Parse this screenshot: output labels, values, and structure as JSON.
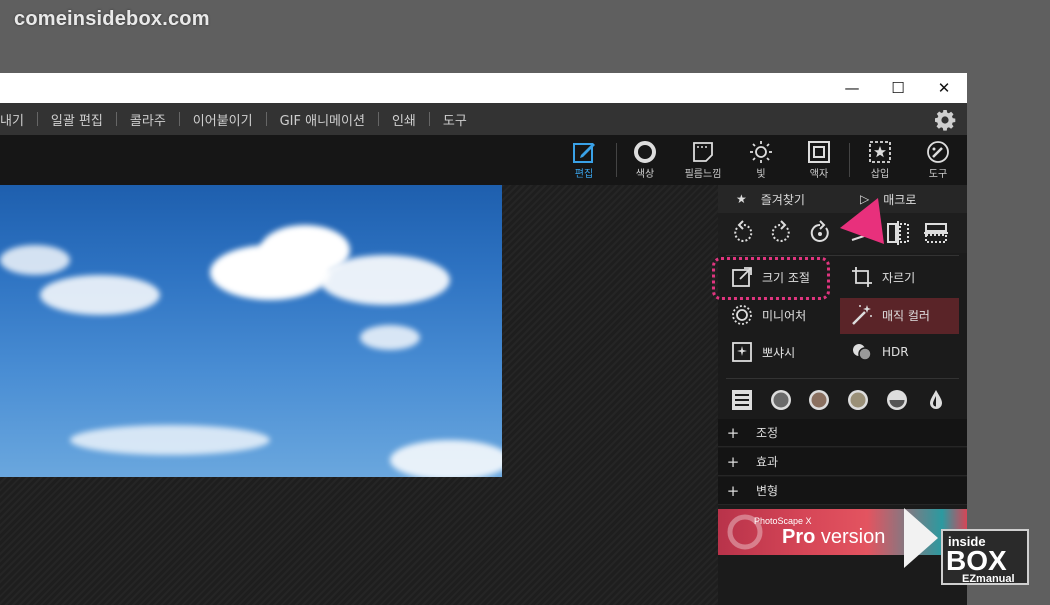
{
  "watermark": "comeinsidebox.com",
  "window_controls": {
    "minimize": "—",
    "maximize": "☐",
    "close": "✕"
  },
  "menu": [
    "내기",
    "일괄 편집",
    "콜라주",
    "이어붙이기",
    "GIF 애니메이션",
    "인쇄",
    "도구"
  ],
  "toolbar": [
    {
      "label": "편집",
      "icon": "edit-icon",
      "active": true
    },
    {
      "label": "색상",
      "icon": "color-icon"
    },
    {
      "label": "필름느낌",
      "icon": "film-icon"
    },
    {
      "label": "빛",
      "icon": "light-icon"
    },
    {
      "label": "액자",
      "icon": "frame-icon"
    },
    {
      "label": "삽입",
      "icon": "insert-icon"
    },
    {
      "label": "도구",
      "icon": "tools-icon"
    }
  ],
  "panel": {
    "favorites": "즐겨찾기",
    "macro": "매크로",
    "tools": {
      "resize": "크기 조절",
      "crop": "자르기",
      "miniature": "미니어처",
      "magic_color": "매직 컬러",
      "bokeh": "뽀샤시",
      "hdr": "HDR"
    },
    "sections": [
      "조정",
      "효과",
      "변형"
    ],
    "pro_banner": {
      "small": "PhotoScape X",
      "pro": "Pro",
      "version": " version"
    }
  },
  "colors": {
    "accent": "#3aa2e8",
    "highlight": "#e0357f",
    "magic_bg": "#5a2428"
  },
  "logo": {
    "top": "inside",
    "middle": "BOX",
    "bottom": "EZmanual"
  }
}
